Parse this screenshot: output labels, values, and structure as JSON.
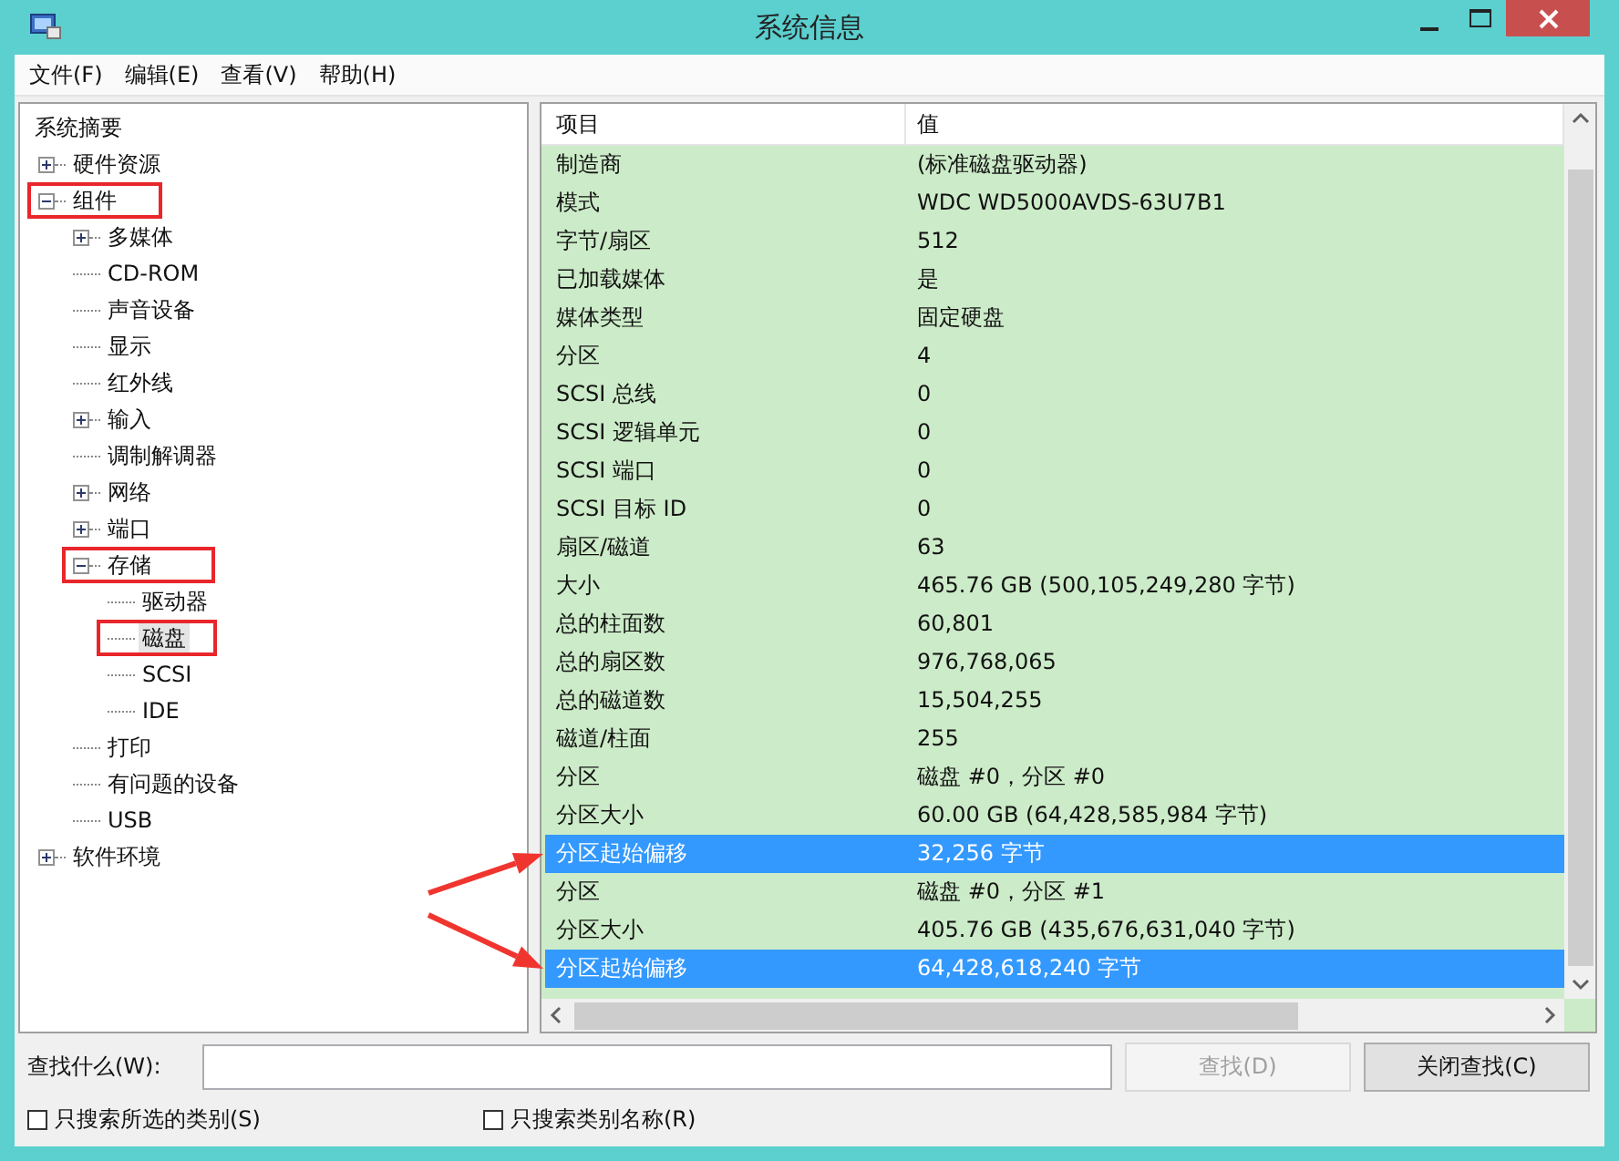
{
  "window": {
    "title": "系统信息"
  },
  "menu": [
    "文件(F)",
    "编辑(E)",
    "查看(V)",
    "帮助(H)"
  ],
  "tree": [
    {
      "label": "系统摘要",
      "kind": "leaf",
      "selected": false,
      "boxed": false
    },
    {
      "label": "硬件资源",
      "kind": "branch",
      "expanded": false,
      "selected": false,
      "boxed": false
    },
    {
      "label": "组件",
      "kind": "branch",
      "expanded": true,
      "selected": false,
      "boxed": true,
      "children": [
        {
          "label": "多媒体",
          "kind": "branch",
          "expanded": false,
          "selected": false,
          "boxed": false
        },
        {
          "label": "CD-ROM",
          "kind": "leaf",
          "selected": false,
          "boxed": false
        },
        {
          "label": "声音设备",
          "kind": "leaf",
          "selected": false,
          "boxed": false
        },
        {
          "label": "显示",
          "kind": "leaf",
          "selected": false,
          "boxed": false
        },
        {
          "label": "红外线",
          "kind": "leaf",
          "selected": false,
          "boxed": false
        },
        {
          "label": "输入",
          "kind": "branch",
          "expanded": false,
          "selected": false,
          "boxed": false
        },
        {
          "label": "调制解调器",
          "kind": "leaf",
          "selected": false,
          "boxed": false
        },
        {
          "label": "网络",
          "kind": "branch",
          "expanded": false,
          "selected": false,
          "boxed": false
        },
        {
          "label": "端口",
          "kind": "branch",
          "expanded": false,
          "selected": false,
          "boxed": false
        },
        {
          "label": "存储",
          "kind": "branch",
          "expanded": true,
          "selected": false,
          "boxed": true,
          "children": [
            {
              "label": "驱动器",
              "kind": "leaf",
              "selected": false,
              "boxed": false
            },
            {
              "label": "磁盘",
              "kind": "leaf",
              "selected": true,
              "boxed": true
            },
            {
              "label": "SCSI",
              "kind": "leaf",
              "selected": false,
              "boxed": false
            },
            {
              "label": "IDE",
              "kind": "leaf",
              "selected": false,
              "boxed": false
            }
          ]
        },
        {
          "label": "打印",
          "kind": "leaf",
          "selected": false,
          "boxed": false
        },
        {
          "label": "有问题的设备",
          "kind": "leaf",
          "selected": false,
          "boxed": false
        },
        {
          "label": "USB",
          "kind": "leaf",
          "selected": false,
          "boxed": false
        }
      ]
    },
    {
      "label": "软件环境",
      "kind": "branch",
      "expanded": false,
      "selected": false,
      "boxed": false
    }
  ],
  "table": {
    "columns": [
      "项目",
      "值"
    ],
    "rows": [
      {
        "item": "制造商",
        "value": "(标准磁盘驱动器)",
        "selected": false,
        "arrow": false
      },
      {
        "item": "模式",
        "value": "WDC WD5000AVDS-63U7B1",
        "selected": false,
        "arrow": false
      },
      {
        "item": "字节/扇区",
        "value": "512",
        "selected": false,
        "arrow": false
      },
      {
        "item": "已加载媒体",
        "value": "是",
        "selected": false,
        "arrow": false
      },
      {
        "item": "媒体类型",
        "value": "固定硬盘",
        "selected": false,
        "arrow": false
      },
      {
        "item": "分区",
        "value": "4",
        "selected": false,
        "arrow": false
      },
      {
        "item": "SCSI 总线",
        "value": "0",
        "selected": false,
        "arrow": false
      },
      {
        "item": "SCSI 逻辑单元",
        "value": "0",
        "selected": false,
        "arrow": false
      },
      {
        "item": "SCSI 端口",
        "value": "0",
        "selected": false,
        "arrow": false
      },
      {
        "item": "SCSI 目标 ID",
        "value": "0",
        "selected": false,
        "arrow": false
      },
      {
        "item": "扇区/磁道",
        "value": "63",
        "selected": false,
        "arrow": false
      },
      {
        "item": "大小",
        "value": "465.76 GB (500,105,249,280 字节)",
        "selected": false,
        "arrow": false
      },
      {
        "item": "总的柱面数",
        "value": "60,801",
        "selected": false,
        "arrow": false
      },
      {
        "item": "总的扇区数",
        "value": "976,768,065",
        "selected": false,
        "arrow": false
      },
      {
        "item": "总的磁道数",
        "value": "15,504,255",
        "selected": false,
        "arrow": false
      },
      {
        "item": "磁道/柱面",
        "value": "255",
        "selected": false,
        "arrow": false
      },
      {
        "item": "分区",
        "value": "磁盘 #0，分区 #0",
        "selected": false,
        "arrow": false
      },
      {
        "item": "分区大小",
        "value": "60.00 GB (64,428,585,984 字节)",
        "selected": false,
        "arrow": false
      },
      {
        "item": "分区起始偏移",
        "value": "32,256 字节",
        "selected": true,
        "arrow": true
      },
      {
        "item": "分区",
        "value": "磁盘 #0，分区 #1",
        "selected": false,
        "arrow": false
      },
      {
        "item": "分区大小",
        "value": "405.76 GB (435,676,631,040 字节)",
        "selected": false,
        "arrow": false
      },
      {
        "item": "分区起始偏移",
        "value": "64,428,618,240 字节",
        "selected": true,
        "arrow": true
      }
    ]
  },
  "find": {
    "label": "查找什么(W):",
    "find_button": {
      "label": "查找(D)",
      "disabled": true
    },
    "close_button": {
      "label": "关闭查找(C)",
      "disabled": false
    },
    "options": [
      {
        "label": "只搜索所选的类别(S)",
        "checked": false
      },
      {
        "label": "只搜索类别名称(R)",
        "checked": false
      }
    ]
  }
}
